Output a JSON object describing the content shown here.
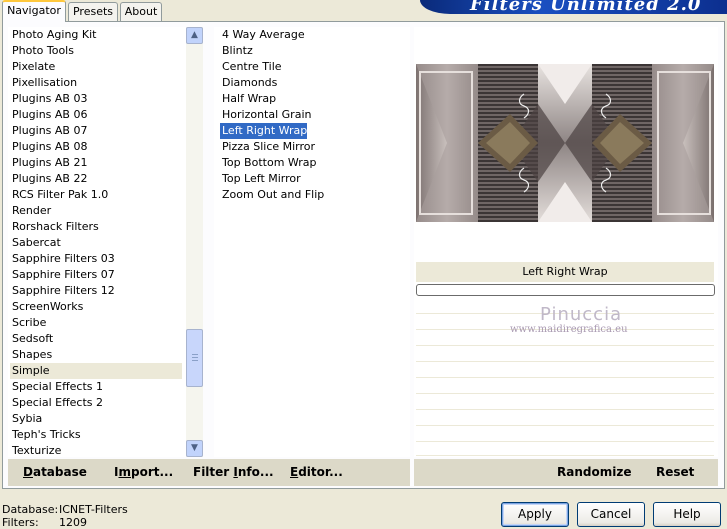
{
  "tabs": [
    {
      "label": "Navigator",
      "active": true
    },
    {
      "label": "Presets",
      "active": false
    },
    {
      "label": "About",
      "active": false
    }
  ],
  "banner_title": "Filters Unlimited 2.0",
  "categories": [
    "Photo Aging Kit",
    "Photo Tools",
    "Pixelate",
    "Pixellisation",
    "Plugins AB 03",
    "Plugins AB 06",
    "Plugins AB 07",
    "Plugins AB 08",
    "Plugins AB 21",
    "Plugins AB 22",
    "RCS Filter Pak 1.0",
    "Render",
    "Rorshack Filters",
    "Sabercat",
    "Sapphire Filters 03",
    "Sapphire Filters 07",
    "Sapphire Filters 12",
    "ScreenWorks",
    "Scribe",
    "Sedsoft",
    "Shapes",
    "Simple",
    "Special Effects 1",
    "Special Effects 2",
    "Sybia",
    "Teph's Tricks",
    "Texturize"
  ],
  "selected_category": "Simple",
  "filters": [
    "4 Way Average",
    "Blintz",
    "Centre Tile",
    "Diamonds",
    "Half Wrap",
    "Horizontal Grain",
    "Left Right Wrap",
    "Pizza Slice Mirror",
    "Top Bottom Wrap",
    "Top Left Mirror",
    "Zoom Out and Flip"
  ],
  "selected_filter": "Left Right Wrap",
  "toolbar_left": {
    "database": {
      "underline": "D",
      "rest": "atabase"
    },
    "import": {
      "pre": "I",
      "underline": "m",
      "rest": "port..."
    },
    "filter_info": {
      "pre": "Filter ",
      "underline": "I",
      "rest": "nfo..."
    },
    "editor": {
      "underline": "E",
      "rest": "ditor..."
    }
  },
  "toolbar_right": {
    "randomize": "Randomize",
    "reset": "Reset"
  },
  "preview_caption": "Left Right Wrap",
  "progress": 0,
  "watermark": {
    "name": "Pinuccia",
    "url": "www.maidiregrafica.eu"
  },
  "status": {
    "database_label": "Database:",
    "database_value": "ICNET-Filters",
    "filters_label": "Filters:",
    "filters_value": "1209"
  },
  "buttons": {
    "apply": "Apply",
    "cancel": "Cancel",
    "help": "Help"
  },
  "icons": {
    "scroll_up": "scroll-up-arrow-icon",
    "scroll_down": "scroll-down-arrow-icon"
  }
}
